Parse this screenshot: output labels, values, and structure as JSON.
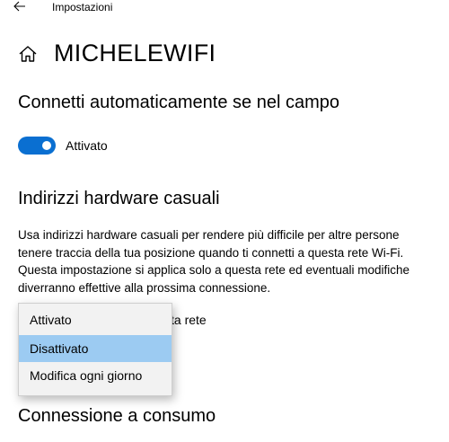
{
  "header": {
    "app_title": "Impostazioni",
    "back_icon": "arrow-left-icon"
  },
  "page": {
    "title": "MICHELEWIFI",
    "home_icon": "home-icon"
  },
  "auto_connect": {
    "heading": "Connetti automaticamente se nel campo",
    "toggle_state": "on",
    "toggle_label": "Attivato",
    "accent_color": "#0a6fd1"
  },
  "random_hw": {
    "heading": "Indirizzi hardware casuali",
    "description": "Usa indirizzi hardware casuali per rendere più difficile per altre persone tenere traccia della tua posizione quando ti connetti a questa rete Wi-Fi. Questa impostazione si applica solo a questa rete ed eventuali modifiche diverranno effettive alla prossima connessione.",
    "partially_hidden_label": "ta rete",
    "dropdown": {
      "options": [
        "Attivato",
        "Disattivato",
        "Modifica ogni giorno"
      ],
      "selected": "Disattivato",
      "highlight_color": "#9ccbf2"
    }
  },
  "metered": {
    "heading": "Connessione a consumo"
  }
}
